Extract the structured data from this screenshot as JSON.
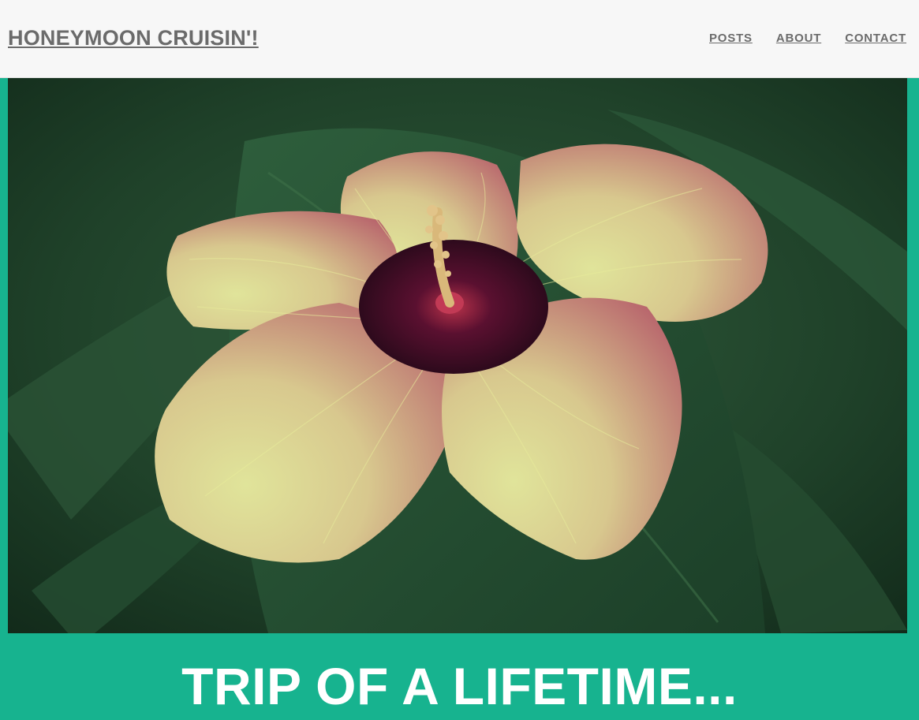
{
  "header": {
    "site_title": "HONEYMOON CRUISIN'!",
    "nav": [
      "POSTS",
      "ABOUT",
      "CONTACT"
    ]
  },
  "hero": {
    "image": "hibiscus-flower-photo"
  },
  "banner": {
    "tagline": "TRIP OF A LIFETIME..."
  },
  "colors": {
    "accent": "#17b38f",
    "header_bg": "#f7f7f7",
    "header_text": "#6b6b6b"
  }
}
